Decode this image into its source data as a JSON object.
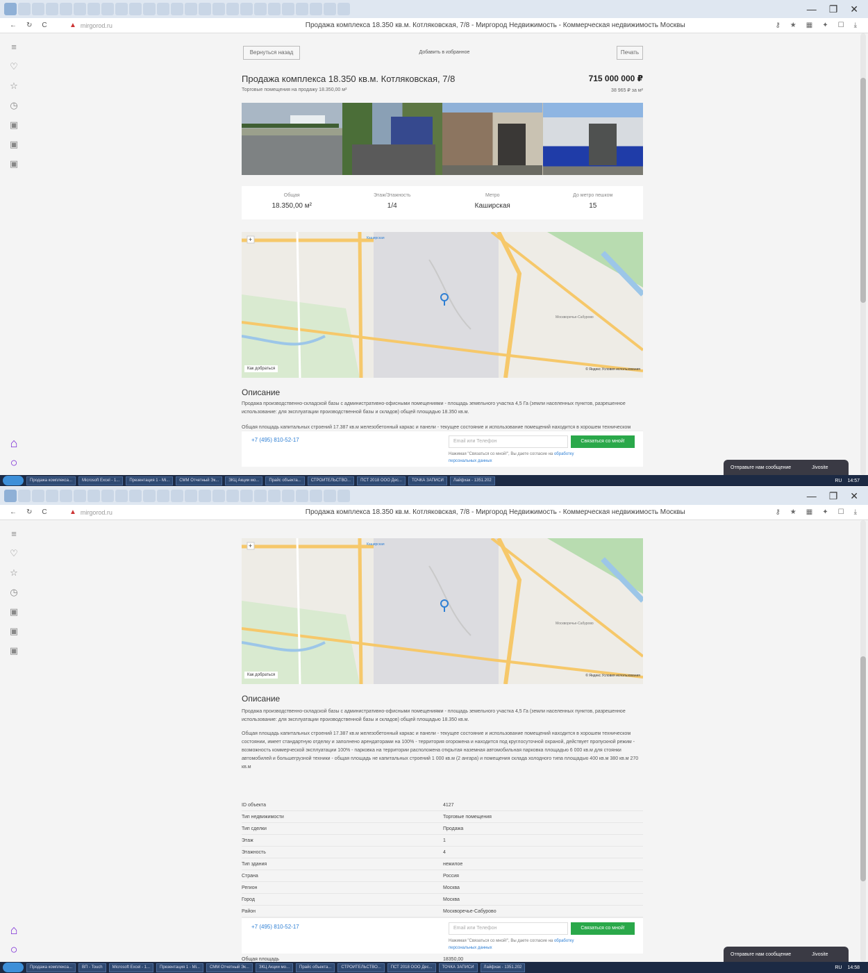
{
  "browser": {
    "site_logo": "▲",
    "site_domain": "mirgorod.ru",
    "page_title": "Продажа комплекса 18.350 кв.м. Котляковская, 7/8 - Миргород Недвижимость - Коммерческая недвижимость Москвы",
    "nav": [
      "←",
      "↻",
      "C"
    ],
    "window_controls": [
      "—",
      "❐",
      "✕"
    ]
  },
  "listing": {
    "back_button": "Вернуться назад",
    "favorites": "Добавить в избранное",
    "print_button": "Печать",
    "title": "Продажа комплекса 18.350 кв.м. Котляковская, 7/8",
    "subtitle": "Торговые помещения на продажу 18.350,00 м²",
    "price": "715 000 000 ₽",
    "price_per_m": "38 965 ₽ за м²",
    "stats": [
      {
        "key": "Общая",
        "value": "18.350,00 м²"
      },
      {
        "key": "Этаж/Этажность",
        "value": "1/4"
      },
      {
        "key": "Метро",
        "value": "Каширская"
      },
      {
        "key": "До метро пешком",
        "value": "15"
      }
    ],
    "desc_title": "Описание",
    "desc_p1": "Продажа производственно-складской базы с административно-офисными помещениями - площадь земельного участка 4,5 Га (земли населенных пунктов, разрешенное использование: для эксплуатации производственной базы и складов) общей площадью 18.350 кв.м.",
    "desc_p2": "Общая площадь капитальных строений 17.387 кв.м железобетонный каркас и панели - текущее состояние и использование помещений находится в хорошем техническом состоянии, имеет стандартную отделку и заполнено арендаторами на 100% - территория огорожена и находится под круглосуточной охраной, действует пропускной режим - возможность коммерческой эксплуатации 100% - парковка на территории расположена открытая наземная автомобильная парковка площадью 6 000 кв.м для стоянки автомобилей и большегрузной техники - общая площадь не капитальных строений 1 000 кв.м (2 ангара) и помещения склада холодного типа площадью 400 кв.м 380 кв.м 270 кв.м",
    "phone": "+7 (495) 810-52-17",
    "email_placeholder": "Email или Телефон",
    "send_button": "Связаться со мной!",
    "agree_text": "Нажимая \"Связаться со мной!\", Вы даете согласие на",
    "agree_link": "обработку персональных данных",
    "map_credit": "© Яндекс Условия использования",
    "map_control": "Как добраться",
    "map_labels": [
      "Каширская",
      "Котляковская",
      "Москворечье-Сабурово"
    ],
    "props": [
      {
        "k": "ID объекта",
        "v": "4127"
      },
      {
        "k": "Тип недвижимости",
        "v": "Торговые помещения"
      },
      {
        "k": "Тип сделки",
        "v": "Продажа"
      },
      {
        "k": "Этаж",
        "v": "1"
      },
      {
        "k": "Этажность",
        "v": "4"
      },
      {
        "k": "Тип здания",
        "v": "нежилое"
      },
      {
        "k": "Страна",
        "v": "Россия"
      },
      {
        "k": "Регион",
        "v": "Москва"
      },
      {
        "k": "Город",
        "v": "Москва"
      },
      {
        "k": "Район",
        "v": "Москворечье-Сабурово"
      }
    ],
    "props_more": {
      "k": "Общая площадь",
      "v": "18350,00"
    }
  },
  "chat": {
    "label": "Отправьте нам сообщение",
    "badge": "Jivosite"
  },
  "taskbar": {
    "tasks_top": [
      "Продажа комплекса...",
      "Microsoft Excel - 1...",
      "Презентация 1 - Mi...",
      "СММ Отчетный Эк...",
      "ЗКЦ Акции мо...",
      "Прайс объекта...",
      "СТРОИТЕЛЬСТВО...",
      "ПСТ 2018 ООО Дес...",
      "ТОЧКА ЗАПИСИ",
      "Лайфхак - 1351.202"
    ],
    "tasks_bot": [
      "Продажа комплекса...",
      "ВП - Touch",
      "Microsoft Excel - 1...",
      "Презентация 1 - Mi...",
      "СММ Отчетный Эк...",
      "ЗКЦ Акции мо...",
      "Прайс объекта...",
      "СТРОИТЕЛЬСТВО...",
      "ПСТ 2018 ООО Дес...",
      "ТОЧКА ЗАПИСИ",
      "Лайфхак - 1351.202"
    ],
    "lang": "RU",
    "time_top": "14:57",
    "time_bot": "14:58"
  },
  "colors": {
    "accent_green": "#2aa84a",
    "link_blue": "#2e7fd4",
    "logo_red": "#cc3333",
    "sidebar_purple": "#7b2bd6"
  }
}
